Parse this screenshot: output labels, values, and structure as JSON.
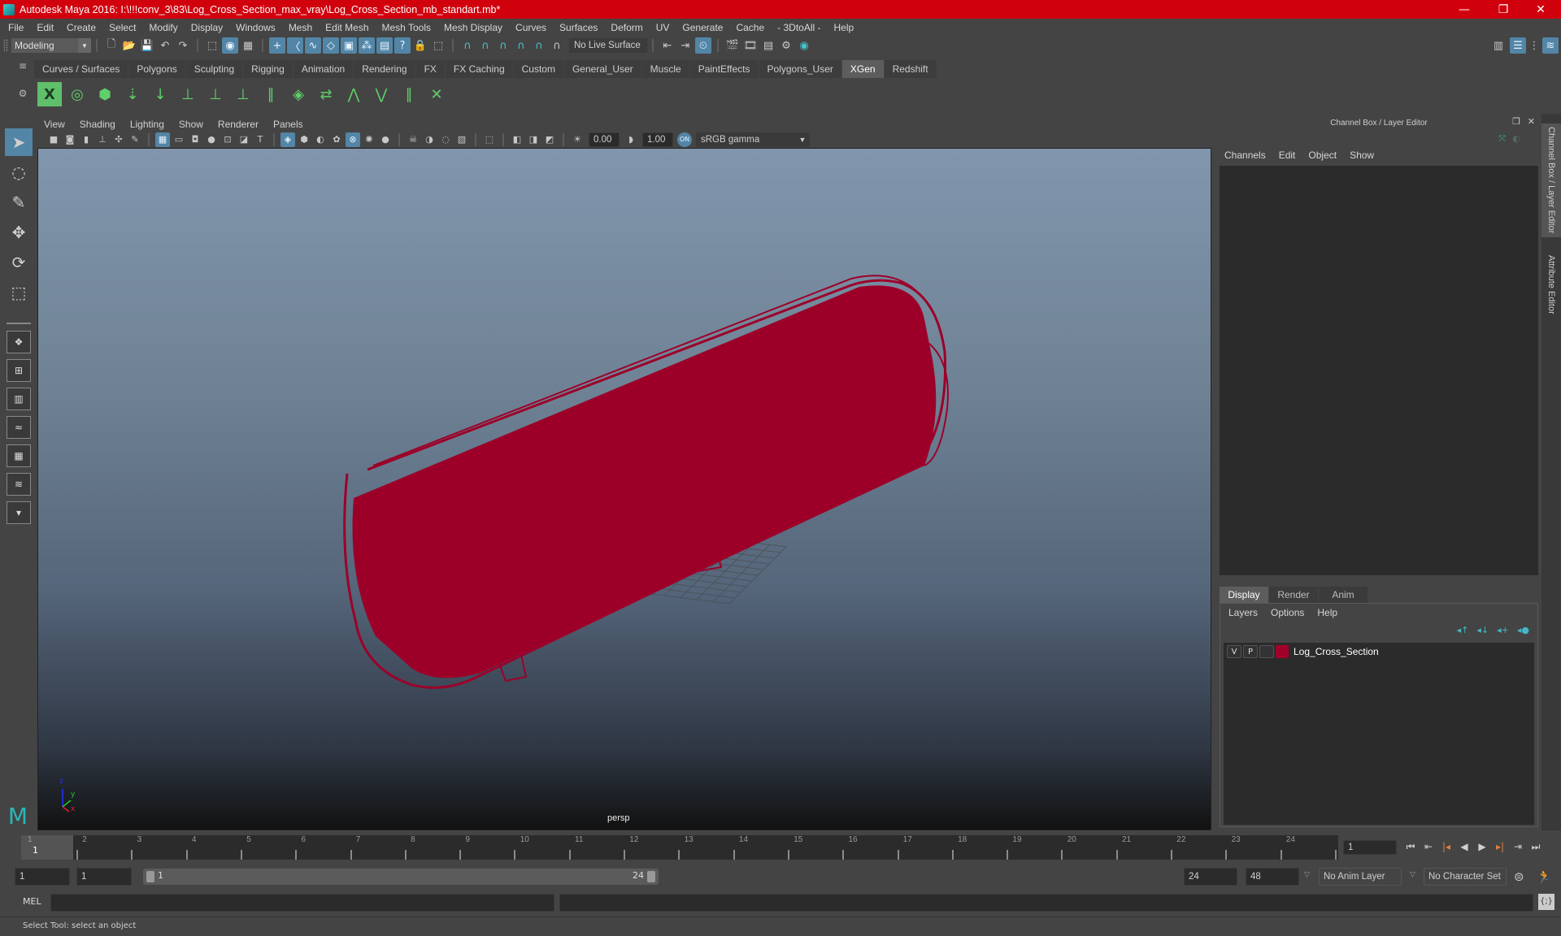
{
  "window": {
    "title": "Autodesk Maya 2016: I:\\!!!conv_3\\83\\Log_Cross_Section_max_vray\\Log_Cross_Section_mb_standart.mb*",
    "minimize": "—",
    "maximize": "❐",
    "close": "✕",
    "title_color": "#d1000d"
  },
  "menubar": [
    "File",
    "Edit",
    "Create",
    "Select",
    "Modify",
    "Display",
    "Windows",
    "Mesh",
    "Edit Mesh",
    "Mesh Tools",
    "Mesh Display",
    "Curves",
    "Surfaces",
    "Deform",
    "UV",
    "Generate",
    "Cache",
    "- 3DtoAll -",
    "Help"
  ],
  "statusline": {
    "mode": "Modeling",
    "live_surface": "No Live Surface",
    "icons": [
      "new-scene",
      "open-scene",
      "save-scene",
      "undo",
      "redo",
      "select-by-hierarchy",
      "select-by-object",
      "select-by-component",
      "snap-to-grid",
      "snap-to-curve",
      "snap-to-point",
      "snap-to-view-plane",
      "make-live",
      "snap-together",
      "render-view",
      "help",
      "lock",
      "select-tool-icons"
    ]
  },
  "shelf": {
    "tabs": [
      "Curves / Surfaces",
      "Polygons",
      "Sculpting",
      "Rigging",
      "Animation",
      "Rendering",
      "FX",
      "FX Caching",
      "Custom",
      "General_User",
      "Muscle",
      "PaintEffects",
      "Polygons_User",
      "XGen",
      "Redshift"
    ],
    "active_tab": "XGen",
    "tools": [
      "xgen-editor",
      "create-description",
      "delete-description",
      "add-guides",
      "place-guide",
      "add-guide",
      "edit-guide",
      "lock-guide",
      "sculpt-guides",
      "convert-to-interactive",
      "guide-attract",
      "guide-flip",
      "guide-cut",
      "guide-smooth",
      "guide-delete"
    ]
  },
  "panel": {
    "menu": [
      "View",
      "Shading",
      "Lighting",
      "Show",
      "Renderer",
      "Panels"
    ],
    "exposure": "0.00",
    "gamma": "1.00",
    "color_space": "sRGB gamma",
    "camera_label": "persp",
    "axis": {
      "x": "x",
      "y": "y",
      "z": "z"
    }
  },
  "channelbox": {
    "header": "Channel Box / Layer Editor",
    "menu": [
      "Channels",
      "Edit",
      "Object",
      "Show"
    ],
    "layer_tabs": [
      "Display",
      "Render",
      "Anim"
    ],
    "active_layer_tab": "Display",
    "layer_menu": [
      "Layers",
      "Options",
      "Help"
    ],
    "layers": [
      {
        "visible": "V",
        "playback": "P",
        "color": "#a0002a",
        "name": "Log_Cross_Section"
      }
    ]
  },
  "sidetabs": [
    "Channel Box / Layer Editor",
    "Attribute Editor"
  ],
  "timeline": {
    "ticks": [
      "1",
      "2",
      "3",
      "4",
      "5",
      "6",
      "7",
      "8",
      "9",
      "10",
      "11",
      "12",
      "13",
      "14",
      "15",
      "16",
      "17",
      "18",
      "19",
      "20",
      "21",
      "22",
      "23",
      "24"
    ],
    "current_frame_marker": "1",
    "current_frame": "1"
  },
  "range": {
    "start": "1",
    "playback_start": "1",
    "slider_start": "1",
    "slider_end": "24",
    "playback_end": "24",
    "end": "48",
    "anim_layer": "No Anim Layer",
    "character_set": "No Character Set"
  },
  "command": {
    "label": "MEL",
    "input": "",
    "result": ""
  },
  "help_line": "Select Tool: select an object",
  "model_color": "#9c0029"
}
